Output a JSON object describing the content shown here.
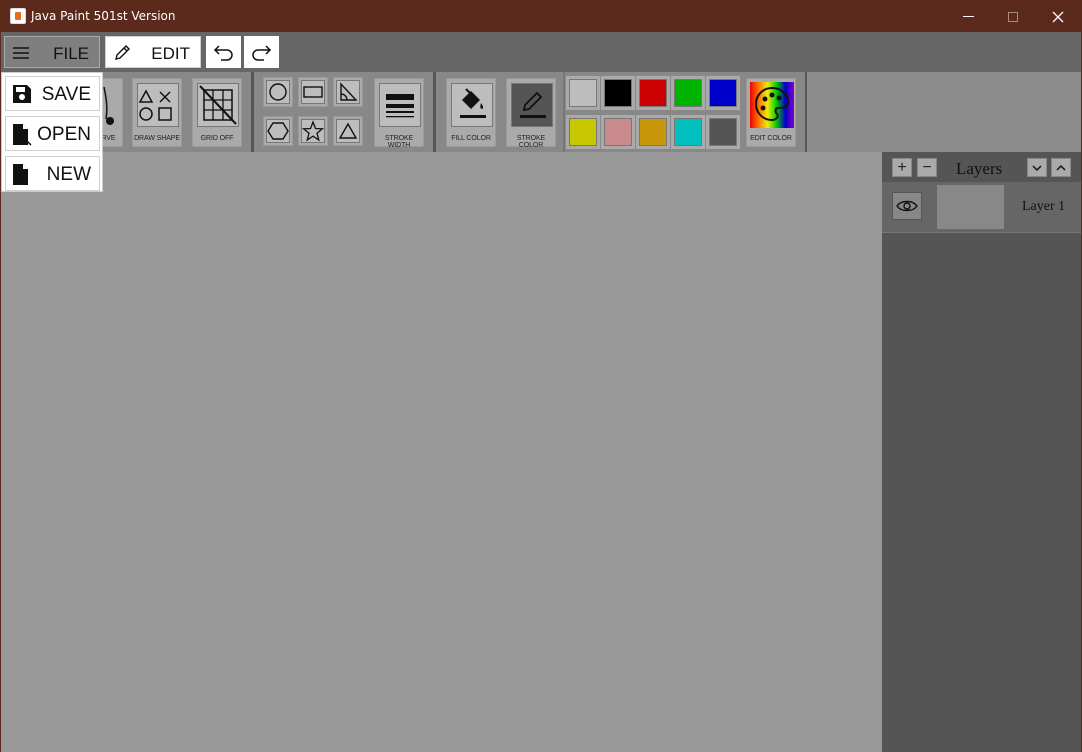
{
  "window": {
    "title": "Java Paint 501st Version",
    "minimize": "minimize",
    "maximize": "maximize",
    "close": "close",
    "close_glyph": "✕"
  },
  "menubar": {
    "file_label": "FILE",
    "edit_label": "EDIT",
    "undo": "undo",
    "redo": "redo"
  },
  "file_menu": {
    "items": [
      {
        "label": "SAVE",
        "icon": "save-icon"
      },
      {
        "label": "OPEN",
        "icon": "open-file-icon"
      },
      {
        "label": "NEW",
        "icon": "new-file-icon"
      }
    ]
  },
  "toolbar": {
    "curve_label": "URVE",
    "draw_shape_label": "DRAW SHAPE",
    "grid_label": "GRID OFF",
    "shapes": [
      "circle-icon",
      "rectangle-icon",
      "right-triangle-icon",
      "hexagon-icon",
      "star-icon",
      "triangle-icon"
    ],
    "stroke_width_label": "STROKE WIDTH",
    "fill_color_label": "FILL COLOR",
    "stroke_color_label": "STROKE COLOR",
    "edit_color_label": "EDIT COLOR",
    "palette": [
      "#bdbdbd",
      "#000000",
      "#cc0000",
      "#00b300",
      "#0000cc",
      "#c8c800",
      "#c88a8a",
      "#c8960a",
      "#00c0c0",
      "#555555"
    ]
  },
  "layers": {
    "title": "Layers",
    "add": "+",
    "remove": "−",
    "items": [
      {
        "name": "Layer 1",
        "visible": true
      }
    ]
  },
  "colors": {
    "titlebar": "#5c2a1d",
    "canvas": "#999999",
    "panel": "#555555"
  }
}
